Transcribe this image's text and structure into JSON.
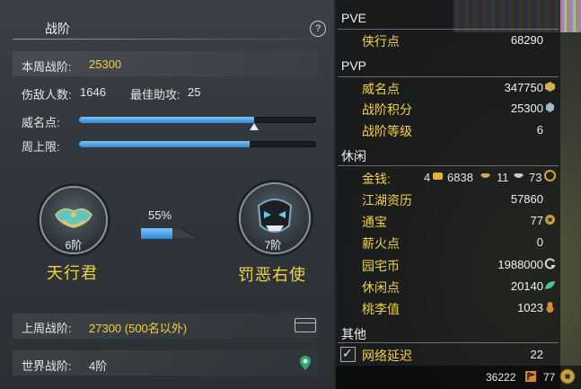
{
  "left_panel": {
    "title": "战阶",
    "help": "?",
    "weekly_rank_label": "本周战阶:",
    "weekly_rank_value": "25300",
    "defeated_label": "伤敌人数:",
    "defeated_value": "1646",
    "best_assist_label": "最佳助攻:",
    "best_assist_value": "25",
    "prestige_label": "威名点:",
    "prestige_progress": 0.74,
    "weekly_cap_label": "周上限:",
    "weekly_cap_progress": 0.72,
    "current_tier": "6阶",
    "current_rank_name": "天行君",
    "next_tier": "7阶",
    "next_rank_name": "罚恶右使",
    "progress_pct": "55%",
    "progress_value": 0.55,
    "last_week_label": "上周战阶:",
    "last_week_value": "27300 (500名以外)",
    "world_rank_label": "世界战阶:",
    "world_rank_value": "4阶"
  },
  "right_panel": {
    "pve_title": "PVE",
    "pve_rows": [
      {
        "label": "侠行点",
        "value": "68290"
      }
    ],
    "pvp_title": "PVP",
    "pvp_rows": [
      {
        "label": "威名点",
        "value": "347750"
      },
      {
        "label": "战阶积分",
        "value": "25300"
      },
      {
        "label": "战阶等级",
        "value": "6"
      }
    ],
    "leisure_title": "休闲",
    "money_label": "金钱:",
    "money_gold": "4",
    "money_silver": "6838",
    "money_copper": "11",
    "money_coin": "73",
    "leisure_rows": [
      {
        "label": "江湖资历",
        "value": "57860"
      },
      {
        "label": "通宝",
        "value": "77"
      },
      {
        "label": "薪火点",
        "value": "0"
      },
      {
        "label": "园宅币",
        "value": "1988000"
      },
      {
        "label": "休闲点",
        "value": "20140"
      },
      {
        "label": "桃李值",
        "value": "1023"
      }
    ],
    "other_title": "其他",
    "network_label": "网络延迟",
    "network_value": "22",
    "bottom_value1": "36222",
    "bottom_value2": "77"
  },
  "colors": {
    "accent_yellow": "#f3d23a",
    "bar_blue": "#3187d6"
  }
}
